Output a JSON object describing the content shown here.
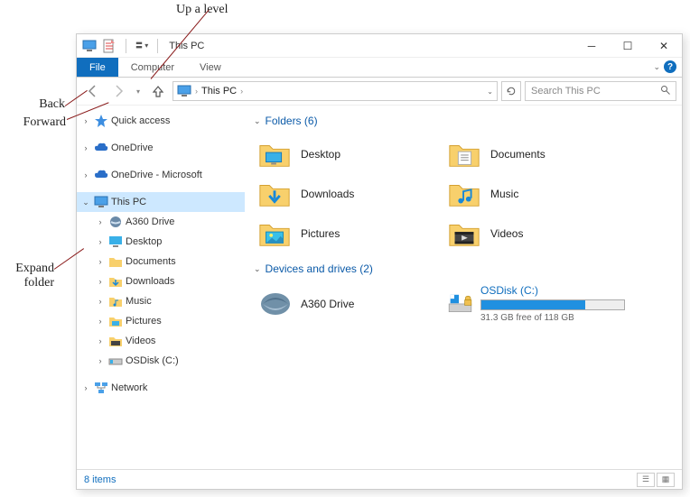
{
  "annotations": {
    "up": "Up a level",
    "back": "Back",
    "forward": "Forward",
    "expand": "Expand\nfolder"
  },
  "titlebar": {
    "title": "This PC"
  },
  "ribbon": {
    "file": "File",
    "computer": "Computer",
    "view": "View"
  },
  "nav": {
    "address_root": "This PC",
    "search_placeholder": "Search This PC"
  },
  "sidebar": {
    "quick_access": "Quick access",
    "onedrive": "OneDrive",
    "onedrive_ms": "OneDrive - Microsoft",
    "this_pc": "This PC",
    "children": {
      "a360": "A360 Drive",
      "desktop": "Desktop",
      "documents": "Documents",
      "downloads": "Downloads",
      "music": "Music",
      "pictures": "Pictures",
      "videos": "Videos",
      "osdisk": "OSDisk (C:)"
    },
    "network": "Network"
  },
  "content": {
    "folders_header": "Folders (6)",
    "devices_header": "Devices and drives (2)",
    "folders": {
      "desktop": "Desktop",
      "documents": "Documents",
      "downloads": "Downloads",
      "music": "Music",
      "pictures": "Pictures",
      "videos": "Videos"
    },
    "drives": {
      "a360": "A360 Drive",
      "osdisk": {
        "name": "OSDisk (C:)",
        "free_text": "31.3 GB free of 118 GB",
        "used_pct": 73
      }
    }
  },
  "statusbar": {
    "count": "8 items"
  }
}
